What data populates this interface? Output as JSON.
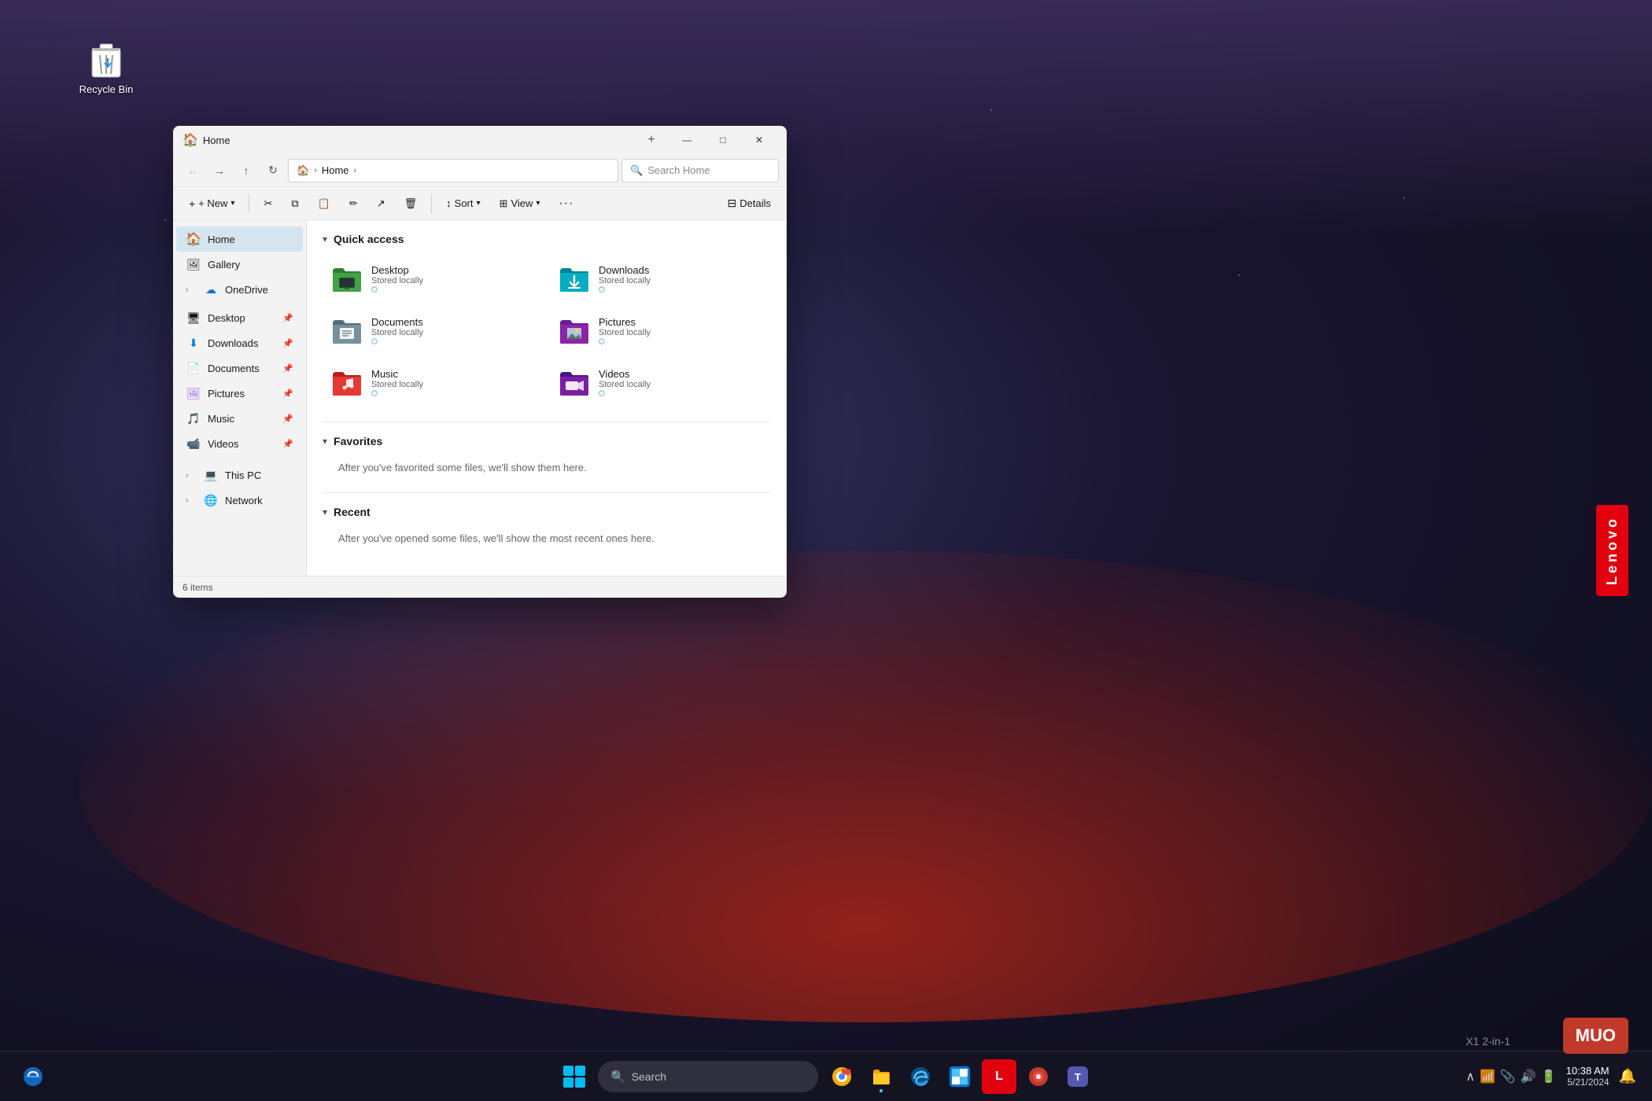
{
  "window": {
    "title": "Home",
    "title_icon": "🏠",
    "new_tab_icon": "+",
    "controls": {
      "minimize": "—",
      "maximize": "□",
      "close": "✕"
    }
  },
  "nav": {
    "back": "←",
    "forward": "→",
    "up": "↑",
    "refresh": "↻",
    "home": "🏠",
    "breadcrumb_home": "Home",
    "search_placeholder": "Search Home"
  },
  "toolbar": {
    "new_label": "+ New",
    "cut_icon": "✂",
    "copy_icon": "⧉",
    "paste_icon": "📋",
    "rename_icon": "✏",
    "share_icon": "↗",
    "delete_icon": "🗑",
    "sort_label": "Sort",
    "sort_icon": "↕",
    "view_label": "View",
    "view_icon": "⊞",
    "more_icon": "•••",
    "details_label": "Details"
  },
  "sidebar": {
    "items": [
      {
        "id": "home",
        "label": "Home",
        "icon": "🏠",
        "active": true
      },
      {
        "id": "gallery",
        "label": "Gallery",
        "icon": "🖼"
      },
      {
        "id": "onedrive",
        "label": "OneDrive",
        "icon": "☁",
        "expandable": true
      },
      {
        "id": "desktop",
        "label": "Desktop",
        "icon": "🖥",
        "pinned": true
      },
      {
        "id": "downloads",
        "label": "Downloads",
        "icon": "⬇",
        "pinned": true
      },
      {
        "id": "documents",
        "label": "Documents",
        "icon": "📄",
        "pinned": true
      },
      {
        "id": "pictures",
        "label": "Pictures",
        "icon": "🖼",
        "pinned": true
      },
      {
        "id": "music",
        "label": "Music",
        "icon": "🎵",
        "pinned": true
      },
      {
        "id": "videos",
        "label": "Videos",
        "icon": "📹",
        "pinned": true
      },
      {
        "id": "this-pc",
        "label": "This PC",
        "icon": "💻",
        "expandable": true
      },
      {
        "id": "network",
        "label": "Network",
        "icon": "🌐",
        "expandable": true
      }
    ]
  },
  "content": {
    "sections": {
      "quick_access": {
        "title": "Quick access",
        "expanded": true
      },
      "favorites": {
        "title": "Favorites",
        "expanded": true,
        "empty_message": "After you've favorited some files, we'll show them here."
      },
      "recent": {
        "title": "Recent",
        "expanded": true,
        "empty_message": "After you've opened some files, we'll show the most recent ones here."
      }
    },
    "folders": [
      {
        "id": "desktop",
        "name": "Desktop",
        "subtitle": "Stored locally",
        "color": "#3d9970",
        "pinned": true
      },
      {
        "id": "downloads",
        "name": "Downloads",
        "subtitle": "Stored locally",
        "color": "#00b4d8",
        "pinned": true
      },
      {
        "id": "documents",
        "name": "Documents",
        "subtitle": "Stored locally",
        "color": "#6c757d",
        "pinned": true
      },
      {
        "id": "pictures",
        "name": "Pictures",
        "subtitle": "Stored locally",
        "color": "#7b2d8b",
        "pinned": true
      },
      {
        "id": "music",
        "name": "Music",
        "subtitle": "Stored locally",
        "color": "#e74c3c",
        "pinned": true
      },
      {
        "id": "videos",
        "name": "Videos",
        "subtitle": "Stored locally",
        "color": "#6f42c1",
        "pinned": true
      }
    ]
  },
  "status_bar": {
    "item_count": "6 items"
  },
  "desktop": {
    "recycle_bin_label": "Recycle Bin"
  },
  "taskbar": {
    "search_placeholder": "Search",
    "time": "10:38 AM",
    "date": "5/21/2024"
  },
  "lenovo": {
    "label": "Lenovo"
  },
  "muo": {
    "label": "MUO"
  },
  "x1_label": "X1 2-in-1"
}
